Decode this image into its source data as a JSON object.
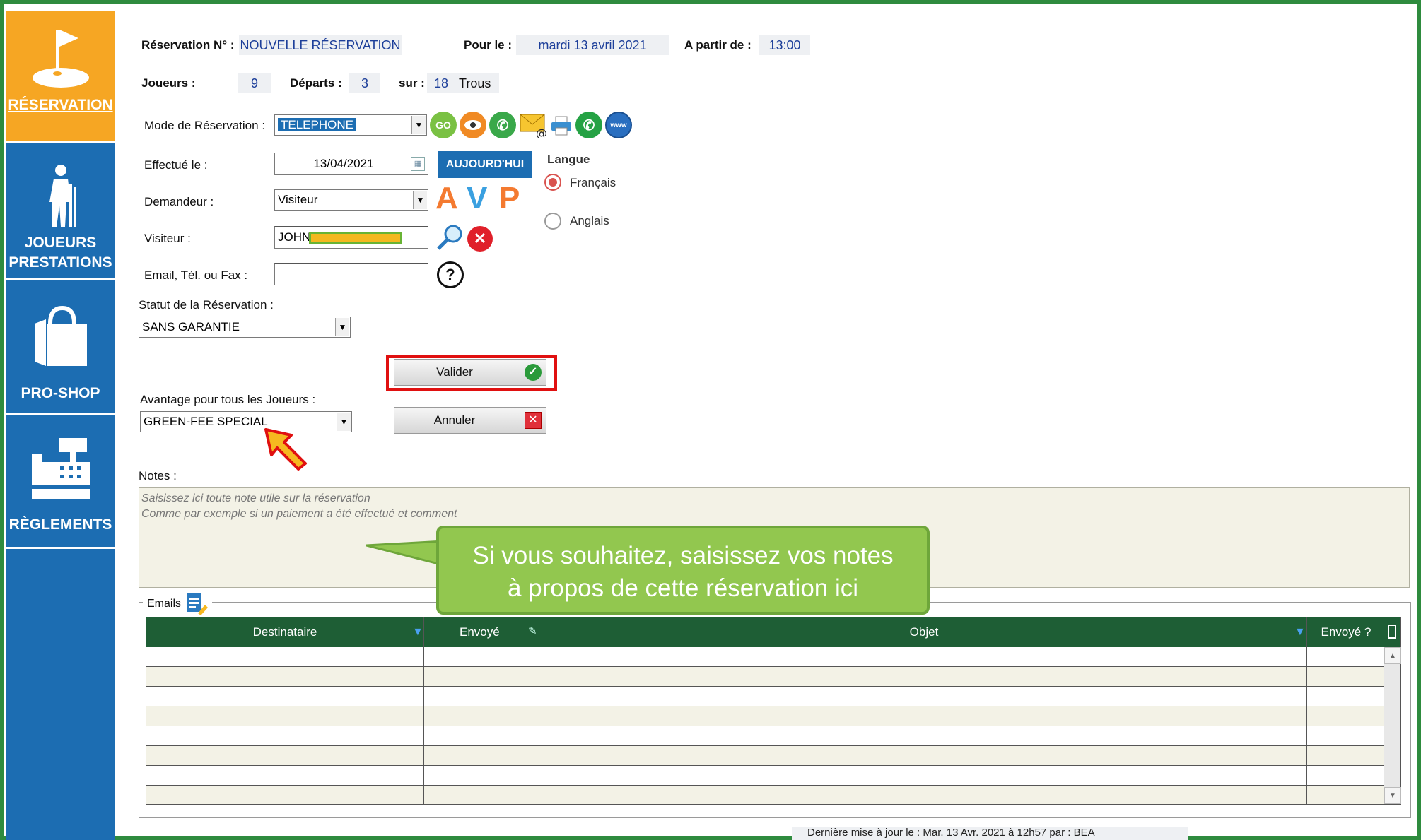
{
  "sidebar": {
    "items": [
      {
        "label": "RÉSERVATION",
        "icon": "golf-flag-icon",
        "active": true
      },
      {
        "label1": "JOUEURS",
        "label2": "PRESTATIONS",
        "icon": "golfer-icon"
      },
      {
        "label": "PRO-SHOP",
        "icon": "shopping-bag-icon"
      },
      {
        "label": "RÈGLEMENTS",
        "icon": "cash-register-icon"
      }
    ],
    "colors": {
      "background": "#1c6db2",
      "active": "#f6a623"
    }
  },
  "header": {
    "reservation_label": "Réservation N° :",
    "reservation_value": "NOUVELLE RÉSERVATION",
    "pour_le_label": "Pour le :",
    "pour_le_value": "mardi 13 avril 2021",
    "a_partir_label": "A partir de :",
    "a_partir_value": "13:00",
    "joueurs_label": "Joueurs :",
    "joueurs_value": "9",
    "departs_label": "Départs :",
    "departs_value": "3",
    "sur_label": "sur :",
    "sur_value": "18",
    "trous_label": "Trous"
  },
  "form": {
    "mode_label": "Mode de Réservation :",
    "mode_value": "TELEPHONE",
    "effectue_label": "Effectué le :",
    "effectue_value": "13/04/2021",
    "today_button": "AUJOURD'HUI",
    "demandeur_label": "Demandeur :",
    "demandeur_value": "Visiteur",
    "visiteur_label": "Visiteur :",
    "visiteur_value": "JOHN",
    "email_label": "Email, Tél. ou Fax :",
    "email_value": "",
    "statut_label": "Statut de la Réservation :",
    "statut_value": "SANS GARANTIE",
    "avantage_label": "Avantage pour tous les Joueurs :",
    "avantage_value": "GREEN-FEE SPECIAL",
    "valider_button": "Valider",
    "annuler_button": "Annuler",
    "avp_letters": [
      "A",
      "V",
      "P"
    ]
  },
  "langue": {
    "title": "Langue",
    "options": [
      {
        "label": "Français",
        "selected": true
      },
      {
        "label": "Anglais",
        "selected": false
      }
    ]
  },
  "notes": {
    "label": "Notes :",
    "placeholder_line1": "Saisissez ici toute note utile sur la réservation",
    "placeholder_line2": "Comme par exemple si un paiement a été effectué et comment"
  },
  "emails": {
    "label": "Emails",
    "columns": [
      "Destinataire",
      "Envoyé",
      "Objet",
      "Envoyé ?"
    ],
    "rows": [
      "",
      "",
      "",
      "",
      "",
      "",
      "",
      ""
    ]
  },
  "callout": {
    "line1": "Si vous souhaitez, saisissez vos notes",
    "line2": "à propos de cette réservation ici"
  },
  "footer": {
    "text": "Dernière mise à jour le :     Mar. 13 Avr. 2021 à 12h57     par :    BEA"
  }
}
